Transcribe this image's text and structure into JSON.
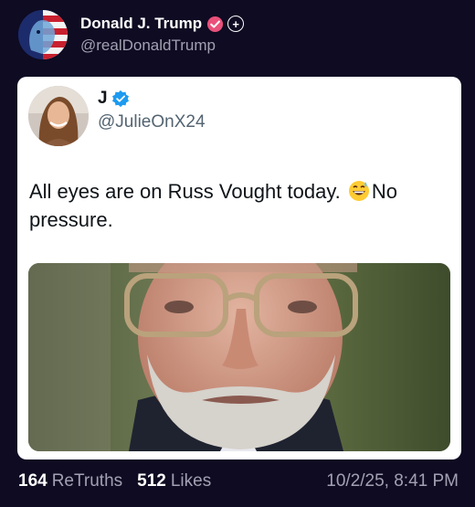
{
  "author": {
    "name": "Donald J. Trump",
    "handle": "@realDonaldTrump"
  },
  "quoted_post": {
    "name": "J",
    "handle": "@JulieOnX24",
    "text_before_emoji": "All eyes are on Russ Vought today.",
    "emoji": "grinning-sweat-emoji",
    "text_after_emoji": "No pressure.",
    "image": "photo-of-man-with-glasses-and-beard"
  },
  "stats": {
    "retruths_count": "164",
    "retruths_label": "ReTruths",
    "likes_count": "512",
    "likes_label": "Likes",
    "timestamp": "10/2/25, 8:41 PM"
  },
  "colors": {
    "background": "#0e0b22",
    "card": "#ffffff",
    "verified_truth": "#e9507a",
    "verified_x": "#1d9bf0",
    "muted": "#a3a0b3"
  }
}
